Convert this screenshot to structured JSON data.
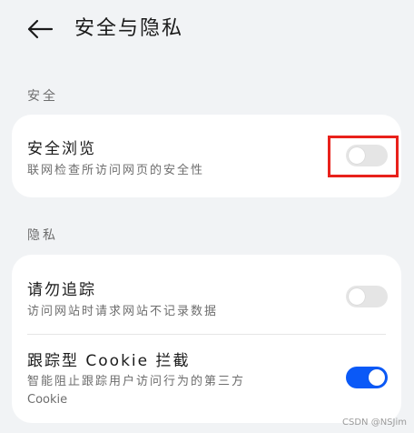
{
  "header": {
    "title": "安全与隐私",
    "back_icon": "back-arrow-icon"
  },
  "sections": {
    "security": {
      "label": "安全",
      "items": [
        {
          "title": "安全浏览",
          "description": "联网检查所访问网页的安全性",
          "enabled": false
        }
      ]
    },
    "privacy": {
      "label": "隐私",
      "items": [
        {
          "title": "请勿追踪",
          "description": "访问网站时请求网站不记录数据",
          "enabled": false
        },
        {
          "title": "跟踪型 Cookie 拦截",
          "description_line1": "智能阻止跟踪用户访问行为的第三方",
          "description_line2": "Cookie",
          "enabled": true
        }
      ]
    }
  },
  "colors": {
    "accent": "#0a59f7",
    "highlight": "#e8211b",
    "background": "#f1f3f5",
    "card": "#ffffff"
  },
  "watermark": "CSDN @NSJim"
}
